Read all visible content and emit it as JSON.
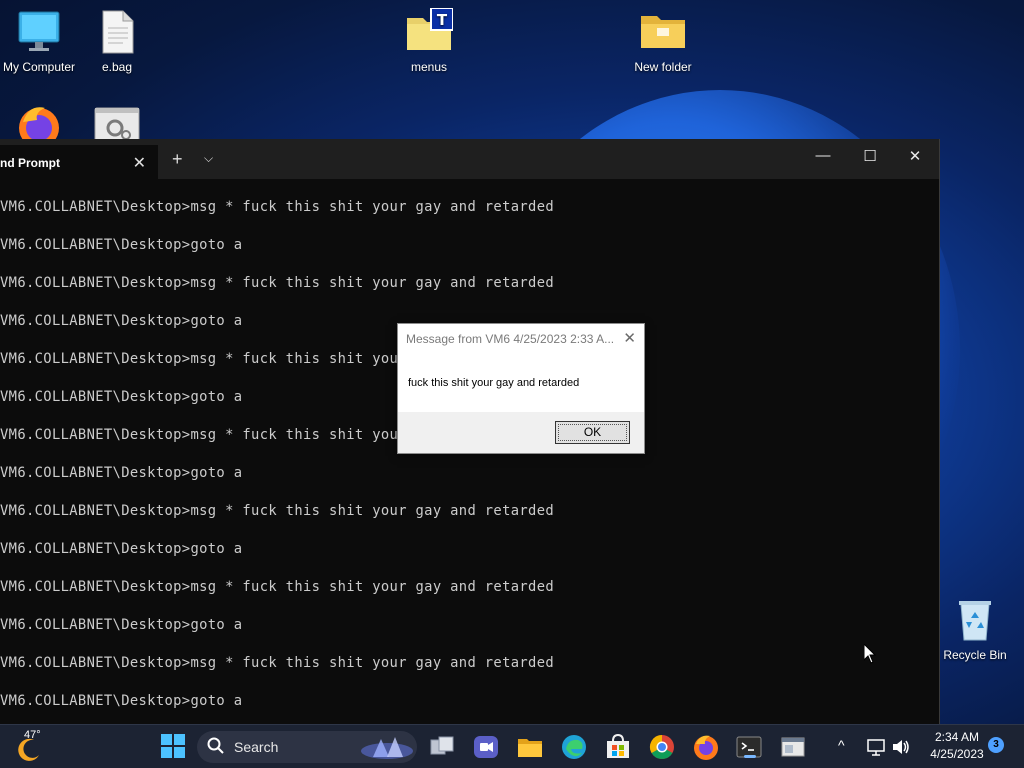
{
  "desktop": {
    "icons": [
      {
        "label": "My Computer",
        "icon": "monitor-icon"
      },
      {
        "label": "e.bag",
        "icon": "document-icon"
      },
      {
        "label": "menus",
        "icon": "folder-icon"
      },
      {
        "label": "New folder",
        "icon": "folder-icon"
      },
      {
        "label": "",
        "icon": "firefox-icon"
      },
      {
        "label": "",
        "icon": "settings-app-icon"
      },
      {
        "label": "Recycle Bin",
        "icon": "recycle-bin-icon"
      }
    ]
  },
  "terminal": {
    "tab_label": "nd Prompt",
    "tab_close": "✕",
    "new_tab": "+",
    "dropdown": "⌵",
    "controls": {
      "minimize": "—",
      "maximize": "☐",
      "close": "✕"
    },
    "lines": [
      "VM6.COLLABNET\\Desktop>msg * fuck this shit your gay and retarded",
      "VM6.COLLABNET\\Desktop>goto a",
      "VM6.COLLABNET\\Desktop>msg * fuck this shit your gay and retarded",
      "VM6.COLLABNET\\Desktop>goto a",
      "VM6.COLLABNET\\Desktop>msg * fuck this shit your gay and retarded",
      "VM6.COLLABNET\\Desktop>goto a",
      "VM6.COLLABNET\\Desktop>msg * fuck this shit your gay and retarded",
      "VM6.COLLABNET\\Desktop>goto a",
      "VM6.COLLABNET\\Desktop>msg * fuck this shit your gay and retarded",
      "VM6.COLLABNET\\Desktop>goto a",
      "VM6.COLLABNET\\Desktop>msg * fuck this shit your gay and retarded",
      "VM6.COLLABNET\\Desktop>goto a",
      "VM6.COLLABNET\\Desktop>msg * fuck this shit your gay and retarded",
      "VM6.COLLABNET\\Desktop>goto a"
    ]
  },
  "dialog": {
    "title": "Message from VM6 4/25/2023 2:33 A...",
    "close": "✕",
    "message": "fuck this shit your gay and retarded",
    "ok_label": "OK"
  },
  "taskbar": {
    "weather_temp": "47°",
    "search_label": "Search",
    "time": "2:34 AM",
    "date": "4/25/2023",
    "notification_count": "3",
    "tray_chevron": "^"
  }
}
